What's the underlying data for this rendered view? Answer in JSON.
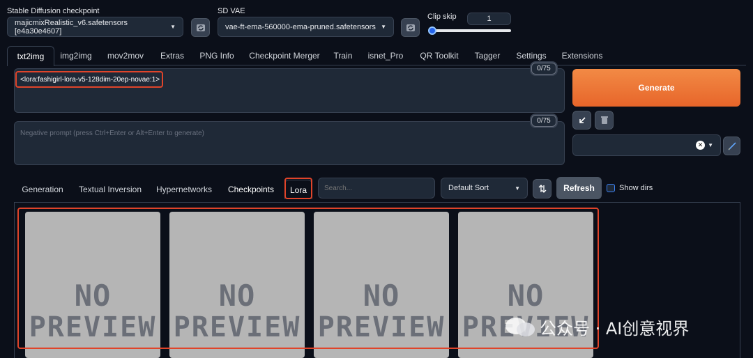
{
  "checkpoint": {
    "label": "Stable Diffusion checkpoint",
    "value": "majicmixRealistic_v6.safetensors [e4a30e4607]"
  },
  "vae": {
    "label": "SD VAE",
    "value": "vae-ft-ema-560000-ema-pruned.safetensors"
  },
  "clip_skip": {
    "label": "Clip skip",
    "value": "1",
    "slider_fraction": 0.0
  },
  "tabs": [
    "txt2img",
    "img2img",
    "mov2mov",
    "Extras",
    "PNG Info",
    "Checkpoint Merger",
    "Train",
    "isnet_Pro",
    "QR Toolkit",
    "Tagger",
    "Settings",
    "Extensions"
  ],
  "prompt": {
    "value": "<lora:fashigirl-lora-v5-128dim-20ep-novae:1>",
    "counter": "0/75"
  },
  "negative_prompt": {
    "placeholder": "Negative prompt (press Ctrl+Enter or Alt+Enter to generate)",
    "counter": "0/75"
  },
  "generate_label": "Generate",
  "subtabs": [
    "Generation",
    "Textual Inversion",
    "Hypernetworks",
    "Checkpoints",
    "Lora"
  ],
  "search": {
    "placeholder": "Search..."
  },
  "sort": {
    "value": "Default Sort"
  },
  "refresh_label": "Refresh",
  "show_dirs_label": "Show dirs",
  "cards": [
    {
      "line1": "NO",
      "line2": "PREVIEW"
    },
    {
      "line1": "NO",
      "line2": "PREVIEW"
    },
    {
      "line1": "NO",
      "line2": "PREVIEW"
    },
    {
      "line1": "NO",
      "line2": "PREVIEW"
    }
  ],
  "watermark": "公众号 · AI创意视界",
  "colors": {
    "accent": "#e7652a",
    "highlight": "#e0442a",
    "background": "#0b0f19"
  }
}
